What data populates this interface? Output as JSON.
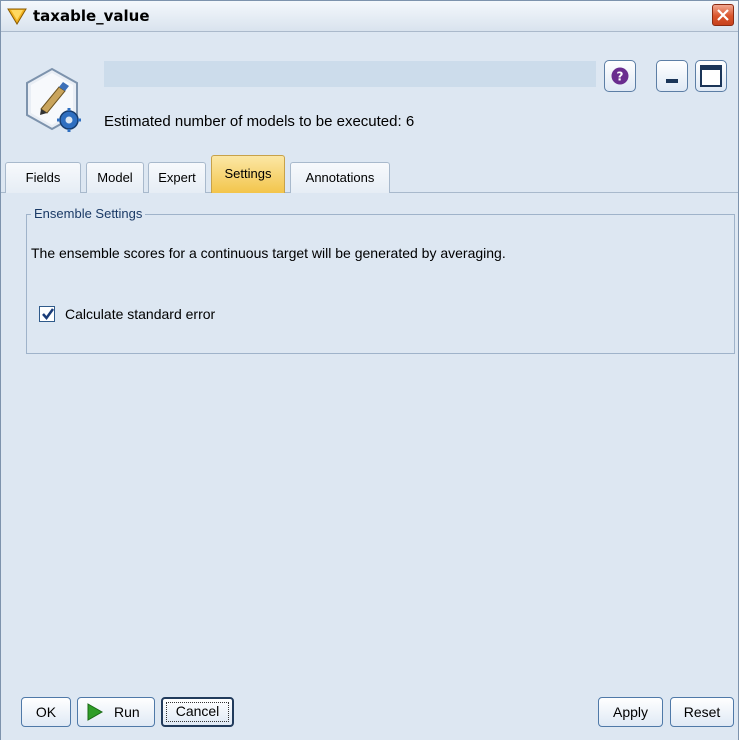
{
  "window": {
    "title": "taxable_value",
    "close_icon": "close-icon"
  },
  "header": {
    "name_value": "",
    "estimate_text": "Estimated number of models to be executed: 6",
    "help_icon": "help-icon",
    "minimize_icon": "minimize-icon",
    "maximize_icon": "maximize-icon"
  },
  "tabs": [
    {
      "label": "Fields",
      "active": false
    },
    {
      "label": "Model",
      "active": false
    },
    {
      "label": "Expert",
      "active": false
    },
    {
      "label": "Settings",
      "active": true
    },
    {
      "label": "Annotations",
      "active": false
    }
  ],
  "settings": {
    "group_title": "Ensemble Settings",
    "description": "The ensemble scores for a continuous target will be generated by averaging.",
    "calc_std_error_label": "Calculate standard error",
    "calc_std_error_checked": true
  },
  "footer": {
    "ok_label": "OK",
    "run_label": "Run",
    "cancel_label": "Cancel",
    "apply_label": "Apply",
    "reset_label": "Reset"
  },
  "colors": {
    "accent_tab": "#f3c54b",
    "background": "#dde7f2",
    "close_button": "#d9552d"
  }
}
